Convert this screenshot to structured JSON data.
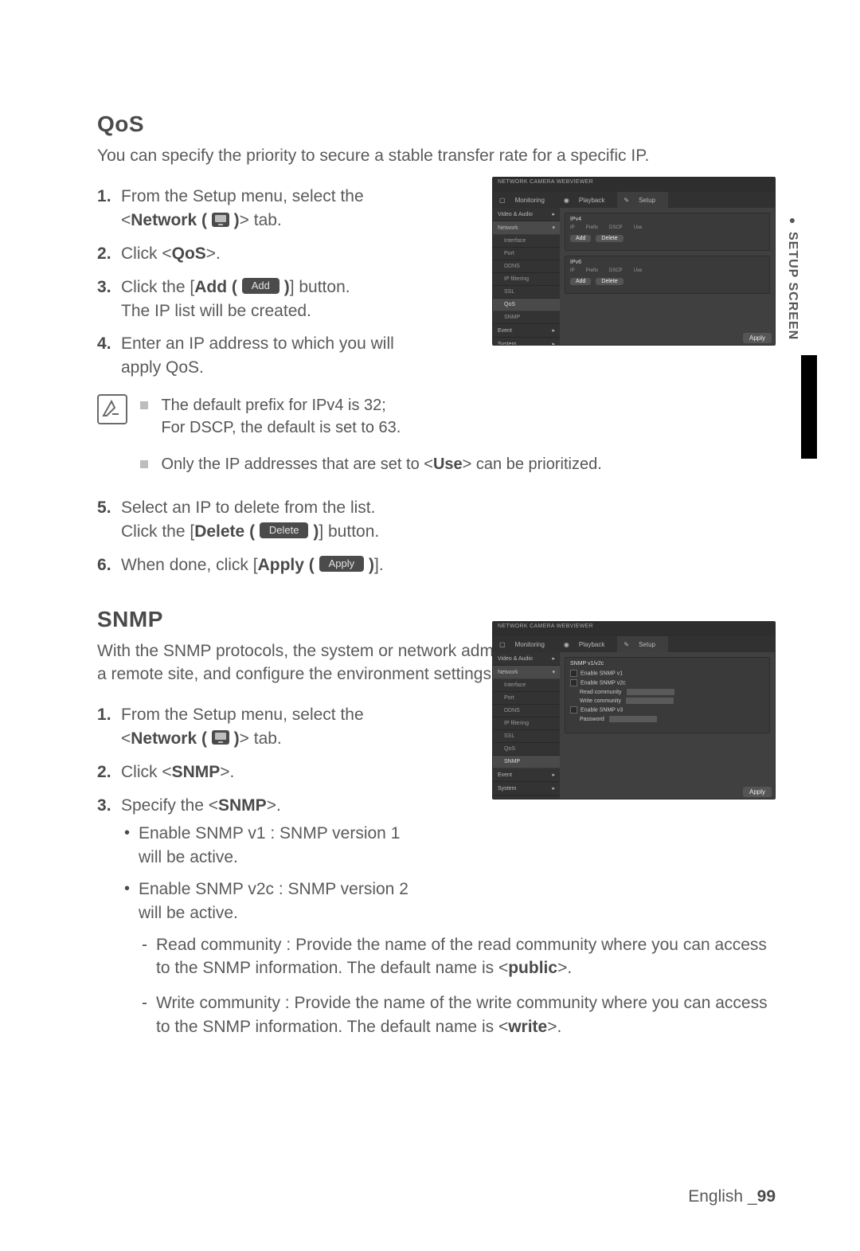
{
  "side_tab": "SETUP SCREEN",
  "sections": {
    "qos": {
      "title": "QoS",
      "intro": "You can specify the priority to secure a stable transfer rate for a specific IP.",
      "steps": {
        "s1a": "From the Setup menu, select the <",
        "s1b": "Network (",
        "s1c": ")",
        "s1d": "> tab.",
        "s2a": "Click <",
        "s2b": "QoS",
        "s2c": ">.",
        "s3a": "Click the [",
        "s3b": "Add (",
        "s3btn": "Add",
        "s3c": ")",
        "s3d": "] button.",
        "s3e": "The IP list will be created.",
        "s4": "Enter an IP address to which you will apply QoS.",
        "note1a": "The default prefix for IPv4 is 32;",
        "note1b": "For DSCP, the default is set to 63.",
        "note2a": "Only the IP addresses that are set to <",
        "note2b": "Use",
        "note2c": "> can be prioritized.",
        "s5a": "Select an IP to delete from the list.",
        "s5b": "Click the [",
        "s5c": "Delete (",
        "s5btn": "Delete",
        "s5d": ")",
        "s5e": "] button.",
        "s6a": "When done, click [",
        "s6b": "Apply (",
        "s6btn": "Apply",
        "s6c": ")",
        "s6d": "]."
      }
    },
    "snmp": {
      "title": "SNMP",
      "intro": "With the SNMP protocols, the system or network admin can monitor the network devices on a remote site, and configure the environment settings.",
      "steps": {
        "s1a": "From the Setup menu, select the <",
        "s1b": "Network (",
        "s1c": ")",
        "s1d": "> tab.",
        "s2a": "Click <",
        "s2b": "SNMP",
        "s2c": ">.",
        "s3a": "Specify the <",
        "s3b": "SNMP",
        "s3c": ">.",
        "b1": "Enable SNMP v1 : SNMP version 1 will be active.",
        "b2": "Enable SNMP v2c : SNMP version 2 will be active.",
        "d1a": "Read community : Provide the name of the read community where you can access to the SNMP information. The default name is <",
        "d1b": "public",
        "d1c": ">.",
        "d2a": "Write community : Provide the name of the write community where you can access to the SNMP information. The default name is <",
        "d2b": "write",
        "d2c": ">."
      }
    }
  },
  "screenshots": {
    "common": {
      "model": "NETWORK CAMERA WEBVIEWER",
      "tab_monitoring": "Monitoring",
      "tab_playback": "Playback",
      "tab_setup": "Setup",
      "side": {
        "video": "Video & Audio",
        "network": "Network",
        "interface": "Interface",
        "port": "Port",
        "ddns": "DDNS",
        "ipfilter": "IP filtering",
        "ssl": "SSL",
        "qos": "QoS",
        "snmp": "SNMP",
        "event": "Event",
        "system": "System"
      },
      "apply": "Apply"
    },
    "qos": {
      "panel_title_ipv4": "IPv4",
      "panel_title_ipv6": "IPv6",
      "col_ip": "IP",
      "col_prefix": "Prefix",
      "col_dscp": "DSCP",
      "col_use": "Use",
      "btn_add": "Add",
      "btn_delete": "Delete"
    },
    "snmp": {
      "panel_title": "SNMP v1/v2c",
      "en_v1": "Enable SNMP v1",
      "en_v2": "Enable SNMP v2c",
      "read": "Read community",
      "write": "Write community",
      "en_v3": "Enable SNMP v3",
      "password": "Password"
    }
  },
  "footer": {
    "lang": "English",
    "sep": "_",
    "page": "99"
  }
}
